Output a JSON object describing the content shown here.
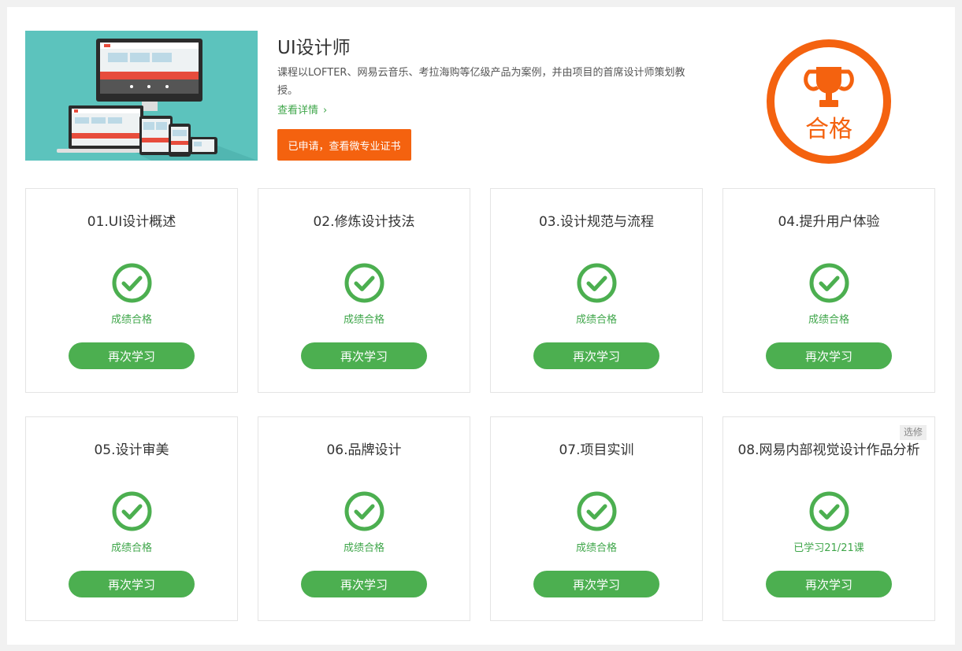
{
  "course": {
    "title": "UI设计师",
    "description": "课程以LOFTER、网易云音乐、考拉海购等亿级产品为案例，并由项目的首席设计师策划教授。",
    "detail_link": "查看详情",
    "cert_button": "已申请，查看微专业证书",
    "seal_text": "合格"
  },
  "colors": {
    "accent_orange": "#f4620f",
    "green": "#4caf50",
    "green_text": "#3fa64a",
    "banner_teal": "#5cc3bd"
  },
  "modules": [
    {
      "title": "01.UI设计概述",
      "status": "成绩合格",
      "button": "再次学习"
    },
    {
      "title": "02.修炼设计技法",
      "status": "成绩合格",
      "button": "再次学习"
    },
    {
      "title": "03.设计规范与流程",
      "status": "成绩合格",
      "button": "再次学习"
    },
    {
      "title": "04.提升用户体验",
      "status": "成绩合格",
      "button": "再次学习"
    },
    {
      "title": "05.设计审美",
      "status": "成绩合格",
      "button": "再次学习"
    },
    {
      "title": "06.品牌设计",
      "status": "成绩合格",
      "button": "再次学习"
    },
    {
      "title": "07.项目实训",
      "status": "成绩合格",
      "button": "再次学习"
    },
    {
      "title": "08.网易内部视觉设计作品分析",
      "status": "已学习21/21课",
      "button": "再次学习",
      "tag": "选修"
    }
  ]
}
